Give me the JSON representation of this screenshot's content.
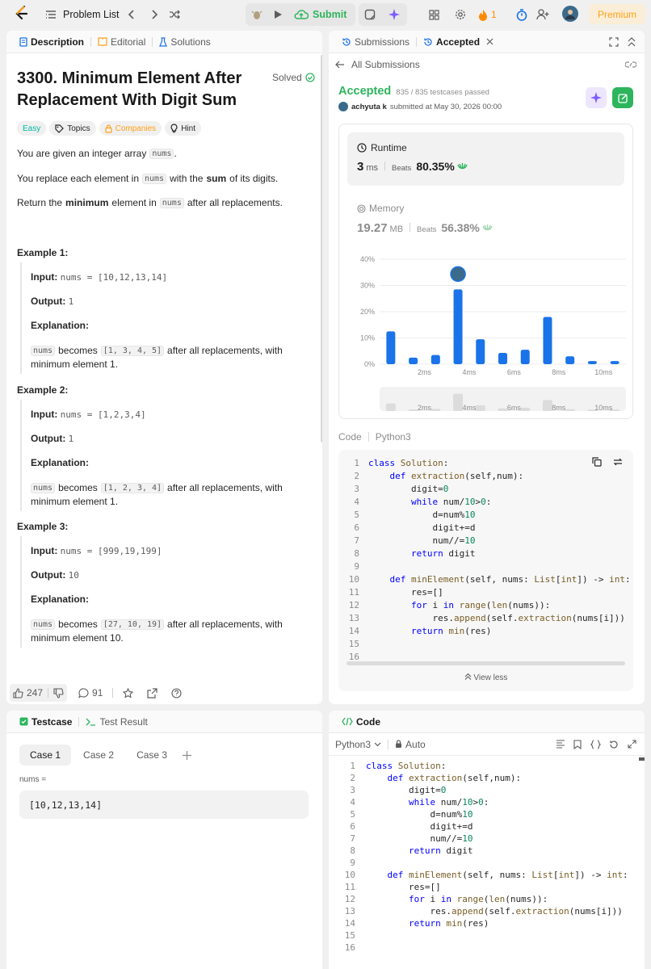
{
  "topbar": {
    "problem_list": "Problem List",
    "submit": "Submit",
    "streak": "1",
    "premium": "Premium"
  },
  "left_tabs": {
    "description": "Description",
    "editorial": "Editorial",
    "solutions": "Solutions"
  },
  "problem": {
    "title_line1": "3300. Minimum Element After",
    "title_line2": "Replacement With Digit Sum",
    "solved": "Solved",
    "difficulty": "Easy",
    "topics": "Topics",
    "companies": "Companies",
    "hint": "Hint",
    "p1_a": "You are given an integer array",
    "p1_code": "nums",
    "p1_b": ".",
    "p2_a": "You replace each element in",
    "p2_code": "nums",
    "p2_b": "with the",
    "p2_bold": "sum",
    "p2_c": "of its digits.",
    "p3_a": "Return the",
    "p3_bold": "minimum",
    "p3_b": "element in",
    "p3_code": "nums",
    "p3_c": "after all replacements.",
    "examples": [
      {
        "title": "Example 1:",
        "input_label": "Input:",
        "input": "nums = [10,12,13,14]",
        "output_label": "Output:",
        "output": "1",
        "explanation_label": "Explanation:",
        "exp_code1": "nums",
        "exp_a": "becomes",
        "exp_code2": "[1, 3, 4, 5]",
        "exp_b": "after all replacements, with",
        "exp_c": "minimum element 1."
      },
      {
        "title": "Example 2:",
        "input_label": "Input:",
        "input": "nums = [1,2,3,4]",
        "output_label": "Output:",
        "output": "1",
        "explanation_label": "Explanation:",
        "exp_code1": "nums",
        "exp_a": "becomes",
        "exp_code2": "[1, 2, 3, 4]",
        "exp_b": "after all replacements, with",
        "exp_c": "minimum element 1."
      },
      {
        "title": "Example 3:",
        "input_label": "Input:",
        "input": "nums = [999,19,199]",
        "output_label": "Output:",
        "output": "10",
        "explanation_label": "Explanation:",
        "exp_code1": "nums",
        "exp_a": "becomes",
        "exp_code2": "[27, 10, 19]",
        "exp_b": "after all replacements, with",
        "exp_c": "minimum element 10."
      }
    ],
    "likes": "247",
    "comments": "91"
  },
  "right_tabs": {
    "submissions": "Submissions",
    "accepted": "Accepted"
  },
  "submission": {
    "all_submissions": "All Submissions",
    "status": "Accepted",
    "testcases": "835 / 835 testcases passed",
    "user": "achyuta k",
    "submitted_at": "submitted at May 30, 2026 00:00",
    "runtime_label": "Runtime",
    "runtime_value": "3",
    "runtime_unit": "ms",
    "beats_label": "Beats",
    "runtime_beats": "80.35%",
    "memory_label": "Memory",
    "memory_value": "19.27",
    "memory_unit": "MB",
    "memory_beats": "56.38%",
    "code_label": "Code",
    "lang_label": "Python3",
    "view_less": "View less"
  },
  "chart_data": {
    "type": "bar",
    "x": [
      0.5,
      1.5,
      2.5,
      3.5,
      4.5,
      5.5,
      6.5,
      7.5,
      8.5,
      9.5,
      10.5
    ],
    "values": [
      12.5,
      2.5,
      3.5,
      28.5,
      9.5,
      4.3,
      5.5,
      18,
      3,
      1.2,
      1.2
    ],
    "highlight_index": 3,
    "yticks": [
      "40%",
      "30%",
      "20%",
      "10%",
      "0%"
    ],
    "ylim": [
      0,
      40
    ],
    "xticks": [
      "2ms",
      "4ms",
      "6ms",
      "8ms",
      "10ms"
    ],
    "xtick_values": [
      2,
      4,
      6,
      8,
      10
    ],
    "xlim": [
      0,
      11
    ],
    "grid": true,
    "color": "#1a73e8"
  },
  "code_lines": [
    "class Solution:",
    "    def extraction(self,num):",
    "        digit=0",
    "        while num/10>0:",
    "            d=num%10",
    "            digit+=d",
    "            num//=10",
    "        return digit",
    "",
    "    def minElement(self, nums: List[int]) -> int:",
    "        res=[]",
    "        for i in range(len(nums)):",
    "            res.append(self.extraction(nums[i]))",
    "        return min(res)",
    "",
    ""
  ],
  "testcase": {
    "tab_testcase": "Testcase",
    "tab_result": "Test Result",
    "case1": "Case 1",
    "case2": "Case 2",
    "case3": "Case 3",
    "var_label": "nums =",
    "var_value": "[10,12,13,14]"
  },
  "editor": {
    "title": "Code",
    "language": "Python3",
    "mode": "Auto"
  }
}
